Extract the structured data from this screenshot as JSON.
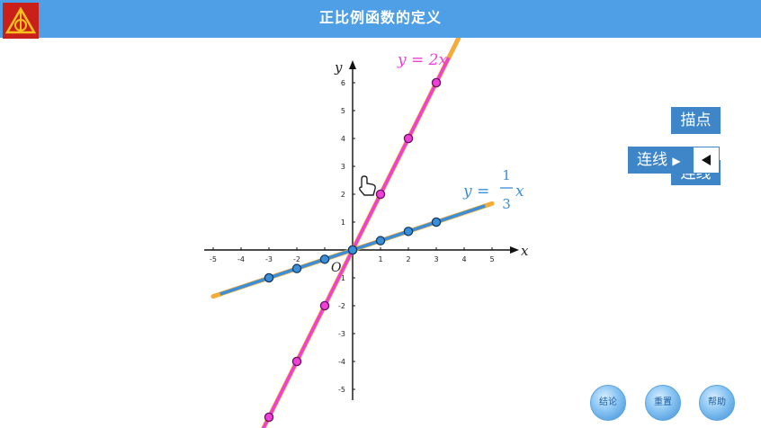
{
  "header": {
    "title": "正比例函数的定义"
  },
  "icons": {
    "logo": "triangle-logo-icon",
    "cursor": "hand-pointer-icon",
    "expand": "triangle-left-icon"
  },
  "colors": {
    "header": "#4f9fe6",
    "pink": "#ee3fd6",
    "blue": "#3b8fd8",
    "orange": "#f5ab3a",
    "button": "#3f86c9"
  },
  "buttons": {
    "miaodian": "描点",
    "lianxian": "连线",
    "lianxian_hidden": "连线"
  },
  "round_buttons": [
    "结论",
    "重置",
    "帮助"
  ],
  "chart_data": {
    "type": "line",
    "xlabel": "x",
    "ylabel": "y",
    "origin_label": "O",
    "xlim": [
      -5,
      5
    ],
    "ylim": [
      -5,
      6
    ],
    "x_ticks": [
      -5,
      -4,
      -3,
      -2,
      -1,
      1,
      2,
      3,
      4,
      5
    ],
    "y_ticks": [
      -5,
      -4,
      -3,
      -2,
      -1,
      1,
      2,
      3,
      4,
      5,
      6
    ],
    "grid": false,
    "series": [
      {
        "name": "y = 2x",
        "formula_prefix": "y = ",
        "formula_suffix": "2x",
        "slope": 2,
        "points": [
          [
            -3,
            -6
          ],
          [
            -2,
            -4
          ],
          [
            -1,
            -2
          ],
          [
            0,
            0
          ],
          [
            1,
            2
          ],
          [
            2,
            4
          ],
          [
            3,
            6
          ]
        ]
      },
      {
        "name": "y = 1/3 x",
        "formula_prefix": "y = ",
        "formula_num": "1",
        "formula_den": "3",
        "formula_var": "x",
        "slope": 0.3333,
        "points": [
          [
            -3,
            -1
          ],
          [
            -2,
            -0.6667
          ],
          [
            -1,
            -0.3333
          ],
          [
            0,
            0
          ],
          [
            1,
            0.3333
          ],
          [
            2,
            0.6667
          ],
          [
            3,
            1
          ]
        ]
      }
    ]
  }
}
